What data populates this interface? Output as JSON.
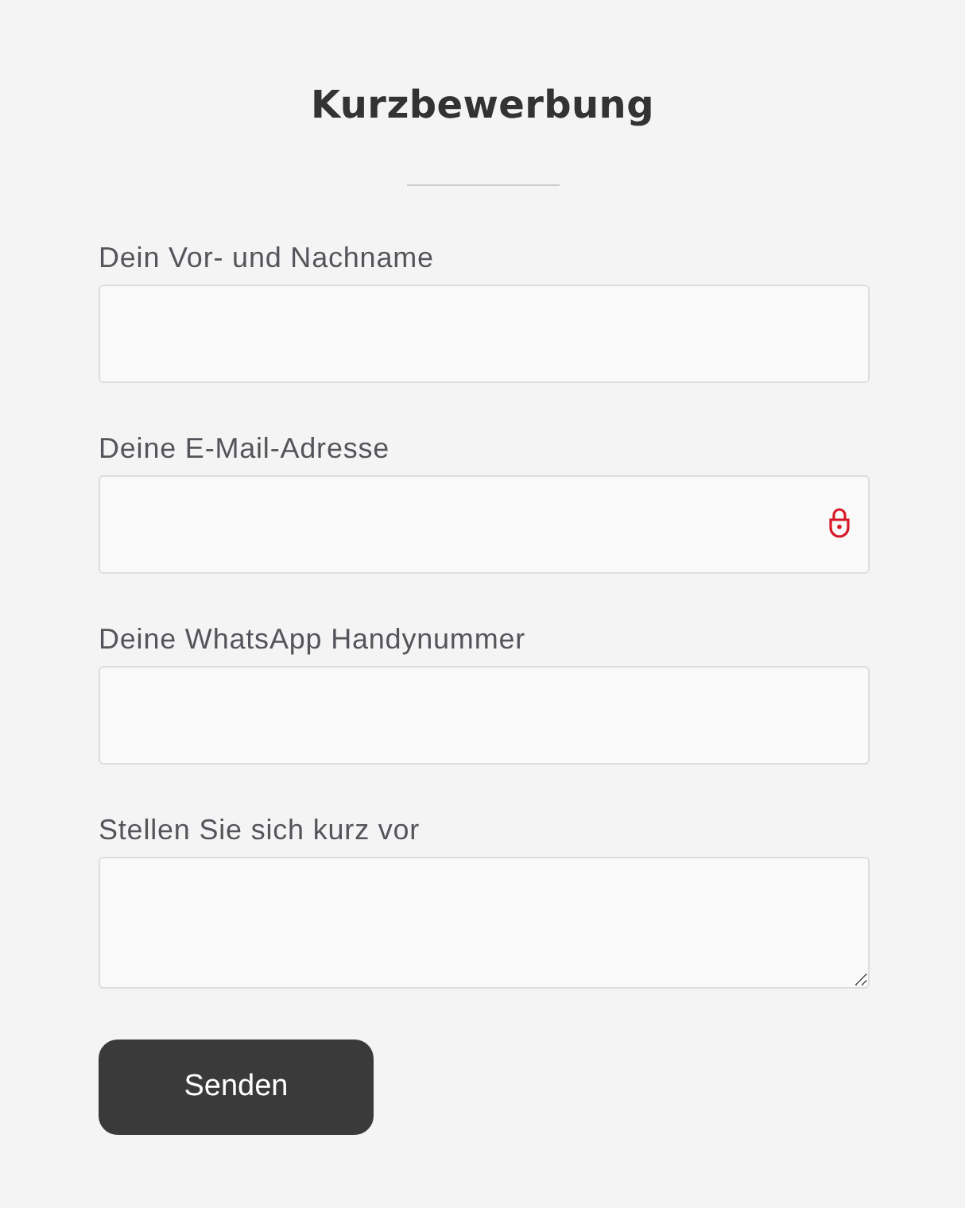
{
  "title": "Kurzbewerbung",
  "fields": [
    {
      "label": "Dein Vor- und Nachname",
      "kind": "text"
    },
    {
      "label": "Deine E-Mail-Adresse",
      "kind": "email"
    },
    {
      "label": "Deine WhatsApp Handynummer",
      "kind": "text"
    },
    {
      "label": "Stellen Sie sich kurz vor",
      "kind": "textarea"
    }
  ],
  "submit": "Senden"
}
